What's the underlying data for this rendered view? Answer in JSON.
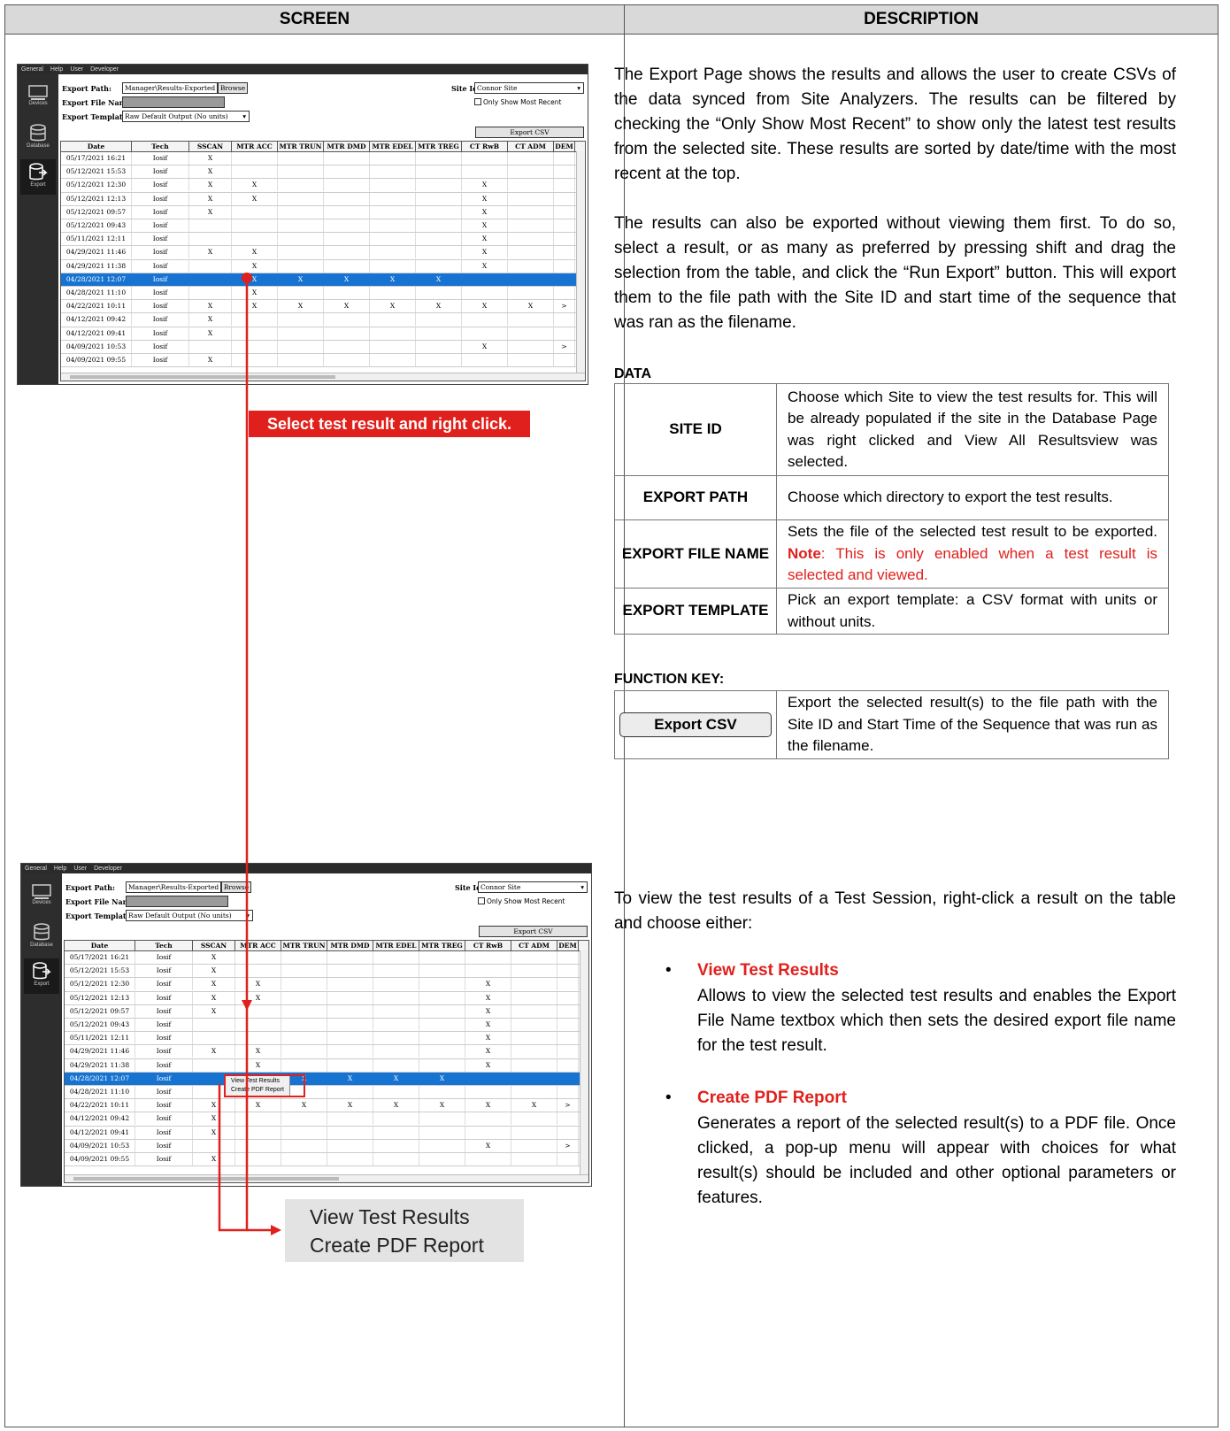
{
  "header": {
    "screen": "SCREEN",
    "description": "DESCRIPTION"
  },
  "app": {
    "menu": [
      "General",
      "Help",
      "User",
      "Developer"
    ],
    "sidebar": [
      "Devices",
      "Database",
      "Export"
    ],
    "export_path_label": "Export Path:",
    "export_path_value": "Manager\\Results-Exported",
    "browse_label": "Browse",
    "export_file_name_label": "Export File Name:",
    "export_template_label": "Export Template:",
    "export_template_value": "Raw Default Output (No units)",
    "site_id_label": "Site Id:",
    "site_id_value": "Connor Site",
    "only_recent_label": "Only Show Most Recent",
    "export_csv_label": "Export CSV",
    "columns": [
      "Date",
      "Tech",
      "SSCAN",
      "MTR ACC",
      "MTR TRUN",
      "MTR DMD",
      "MTR EDEL",
      "MTR TREG",
      "CT RwB",
      "CT ADM",
      "DEM"
    ],
    "rows": [
      [
        "05/17/2021 16:21",
        "Iosif",
        "X",
        "",
        "",
        "",
        "",
        "",
        "",
        "",
        ""
      ],
      [
        "05/12/2021 15:53",
        "Iosif",
        "X",
        "",
        "",
        "",
        "",
        "",
        "",
        "",
        ""
      ],
      [
        "05/12/2021 12:30",
        "Iosif",
        "X",
        "X",
        "",
        "",
        "",
        "",
        "X",
        "",
        ""
      ],
      [
        "05/12/2021 12:13",
        "Iosif",
        "X",
        "X",
        "",
        "",
        "",
        "",
        "X",
        "",
        ""
      ],
      [
        "05/12/2021 09:57",
        "Iosif",
        "X",
        "",
        "",
        "",
        "",
        "",
        "X",
        "",
        ""
      ],
      [
        "05/12/2021 09:43",
        "Iosif",
        "",
        "",
        "",
        "",
        "",
        "",
        "X",
        "",
        ""
      ],
      [
        "05/11/2021 12:11",
        "Iosif",
        "",
        "",
        "",
        "",
        "",
        "",
        "X",
        "",
        ""
      ],
      [
        "04/29/2021 11:46",
        "Iosif",
        "X",
        "X",
        "",
        "",
        "",
        "",
        "X",
        "",
        ""
      ],
      [
        "04/29/2021 11:38",
        "Iosif",
        "",
        "X",
        "",
        "",
        "",
        "",
        "X",
        "",
        ""
      ],
      [
        "04/28/2021 12:07",
        "Iosif",
        "",
        "X",
        "X",
        "X",
        "X",
        "X",
        "",
        "",
        ""
      ],
      [
        "04/28/2021 11:10",
        "Iosif",
        "",
        "X",
        "",
        "",
        "",
        "",
        "",
        "",
        ""
      ],
      [
        "04/22/2021 10:11",
        "Iosif",
        "X",
        "X",
        "X",
        "X",
        "X",
        "X",
        "X",
        "X",
        ">"
      ],
      [
        "04/12/2021 09:42",
        "Iosif",
        "X",
        "",
        "",
        "",
        "",
        "",
        "",
        "",
        ""
      ],
      [
        "04/12/2021 09:41",
        "Iosif",
        "X",
        "",
        "",
        "",
        "",
        "",
        "",
        "",
        ""
      ],
      [
        "04/09/2021 10:53",
        "Iosif",
        "",
        "",
        "",
        "",
        "",
        "",
        "X",
        "",
        ">"
      ],
      [
        "04/09/2021 09:55",
        "Iosif",
        "X",
        "",
        "",
        "",
        "",
        "",
        "",
        "",
        ""
      ]
    ],
    "context_menu": [
      "View Test Results",
      "Create PDF Report"
    ]
  },
  "callout": "Select test result and right click.",
  "zoom_menu": [
    "View Test Results",
    "Create PDF Report"
  ],
  "desc": {
    "p1": "The Export Page shows the results and allows the user to create CSVs of the data synced from Site Analyzers. The results can be filtered by checking the “Only Show Most Recent” to show only the latest test results from the selected site. These results are sorted by date/time with the most recent at the top.",
    "p2": "The results can also be exported without viewing them first. To do so, select a result, or as many as preferred by pressing shift and drag the selection from the table, and click the “Run Export” button. This will export them to the file path with the Site ID and start time of the sequence that was ran as the filename.",
    "data_title": "DATA",
    "defs": [
      {
        "k": "SITE ID",
        "v": "Choose which Site to view the test results for. This will be already populated if the site in the Database Page was right clicked and View All Resultsview was selected."
      },
      {
        "k": "EXPORT PATH",
        "v": "Choose which directory to export the test results."
      },
      {
        "k": "EXPORT FILE NAME",
        "v": "Sets the file of the selected test result to be exported.",
        "note_label": "Note",
        "note": ": This is only enabled when a test result is selected and viewed."
      },
      {
        "k": "EXPORT TEMPLATE",
        "v": "Pick an export template: a CSV format with units or without units."
      }
    ],
    "fk_title": "FUNCTION KEY:",
    "fk_button": "Export CSV",
    "fk_desc": "Export the selected result(s) to the file path with the Site ID and Start Time of the Sequence that was run as the filename.",
    "p3": "To view the test results of a Test Session, right-click a result on the table and choose either:",
    "b1_title": "View Test Results",
    "b1_body": "Allows to view the selected test results and enables the Export File Name textbox which then sets the desired export file name for the test result.",
    "b2_title": "Create PDF Report",
    "b2_body": "Generates a report of the selected result(s) to a PDF file. Once clicked, a pop-up menu will appear with choices for what result(s) should be included and other optional parameters or features."
  },
  "colors": {
    "accent": "#e0201c",
    "selection": "#1773d1",
    "header_bg": "#d9d9d9"
  }
}
